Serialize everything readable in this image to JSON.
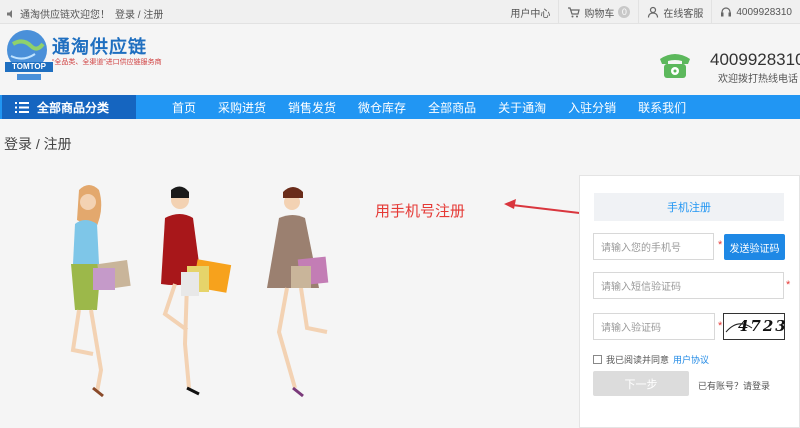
{
  "topbar": {
    "welcome": "通淘供应链欢迎您！",
    "login": "登录",
    "slash": "/",
    "register": "注册",
    "user_center": "用户中心",
    "cart": "购物车",
    "cart_count": "0",
    "service": "在线客服",
    "phone": "4009928310"
  },
  "header": {
    "logo_name": "通淘供应链",
    "logo_badge": "TOMTOP",
    "logo_slogan": "“全品类、全渠道”进口供应链服务商",
    "hotline_number": "4009928310",
    "hotline_text": "欢迎拨打热线电话"
  },
  "nav": {
    "category": "全部商品分类",
    "items": [
      "首页",
      "采购进货",
      "销售发货",
      "微仓库存",
      "全部商品",
      "关于通淘",
      "入驻分销",
      "联系我们"
    ]
  },
  "breadcrumb": "登录 / 注册",
  "banner": {
    "text": "用手机号注册"
  },
  "register": {
    "tab": "手机注册",
    "phone_placeholder": "请输入您的手机号",
    "sms_button": "发送验证码",
    "sms_placeholder": "请输入短信验证码",
    "captcha_placeholder": "请输入验证码",
    "captcha_text": "4723",
    "agree_text": "我已阅读并同意",
    "agreement_link": "用户协议",
    "next_button": "下一步",
    "have_account": "已有账号？请登录"
  },
  "colors": {
    "primary": "#2196f3",
    "dark_blue": "#1565c0",
    "alert_red": "#e53935"
  }
}
